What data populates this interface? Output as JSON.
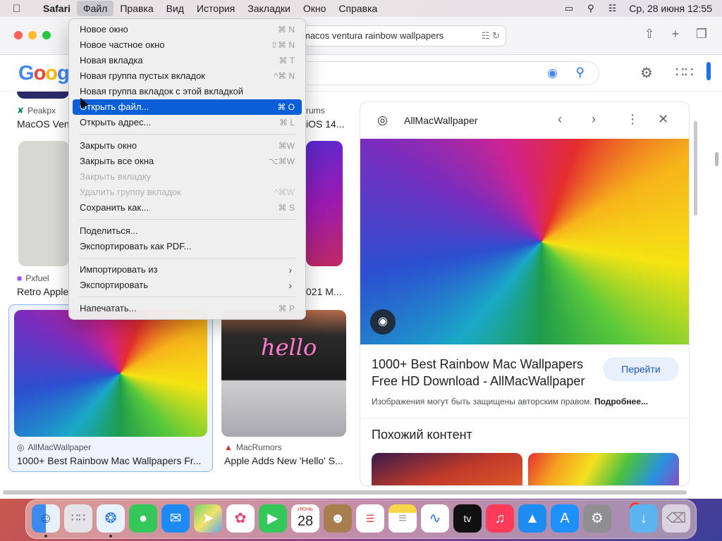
{
  "menubar": {
    "app": "Safari",
    "items": [
      "Файл",
      "Правка",
      "Вид",
      "История",
      "Закладки",
      "Окно",
      "Справка"
    ],
    "clock": "Ср, 28 июня  12:55"
  },
  "browser": {
    "url": "macos ventura rainbow wallpapers"
  },
  "google": {
    "logo": "Google"
  },
  "results": {
    "row1": [
      {
        "source": "Peakpx",
        "title": "MacOS Ven"
      },
      {
        "source": "rums",
        "title": "iOS 14..."
      }
    ],
    "row2": [
      {
        "source": "Pxfuel",
        "title": "Retro Apple"
      },
      {
        "source": "",
        "title": "021 M..."
      }
    ],
    "row3": [
      {
        "source": "AllMacWallpaper",
        "title": "1000+ Best Rainbow Mac Wallpapers Fr..."
      },
      {
        "source": "MacRumors",
        "title": "Apple Adds New 'Hello' S..."
      }
    ],
    "hello_text": "hello"
  },
  "panel": {
    "site": "AllMacWallpaper",
    "title": "1000+ Best Rainbow Mac Wallpapers Free HD Download - AllMacWallpaper",
    "go_button": "Перейти",
    "note": "Изображения могут быть защищены авторским правом.",
    "note_link": "Подробнее...",
    "similar": "Похожий контент"
  },
  "file_menu": {
    "groups": [
      [
        {
          "label": "Новое окно",
          "shortcut": "⌘ N"
        },
        {
          "label": "Новое частное окно",
          "shortcut": "⇧⌘ N"
        },
        {
          "label": "Новая вкладка",
          "shortcut": "⌘ T"
        },
        {
          "label": "Новая группа пустых вкладок",
          "shortcut": "^⌘ N"
        },
        {
          "label": "Новая группа вкладок с этой вкладкой",
          "shortcut": ""
        },
        {
          "label": "Открыть файл...",
          "shortcut": "⌘ O"
        },
        {
          "label": "Открыть адрес...",
          "shortcut": "⌘ L"
        }
      ],
      [
        {
          "label": "Закрыть окно",
          "shortcut": "⌘W"
        },
        {
          "label": "Закрыть все окна",
          "shortcut": "⌥⌘W"
        },
        {
          "label": "Закрыть вкладку",
          "shortcut": ""
        },
        {
          "label": "Удалить группу вкладок",
          "shortcut": "^⌘W"
        },
        {
          "label": "Сохранить как...",
          "shortcut": "⌘ S"
        }
      ],
      [
        {
          "label": "Поделиться...",
          "shortcut": ""
        },
        {
          "label": "Экспортировать как PDF...",
          "shortcut": ""
        }
      ],
      [
        {
          "label": "Импортировать из",
          "shortcut": ""
        },
        {
          "label": "Экспортировать",
          "shortcut": ""
        }
      ],
      [
        {
          "label": "Напечатать...",
          "shortcut": "⌘ P"
        }
      ]
    ]
  },
  "dock": {
    "calendar_month": "ИЮНЬ",
    "calendar_day": "28",
    "tv_label": "tv",
    "settings_badge": "1"
  }
}
